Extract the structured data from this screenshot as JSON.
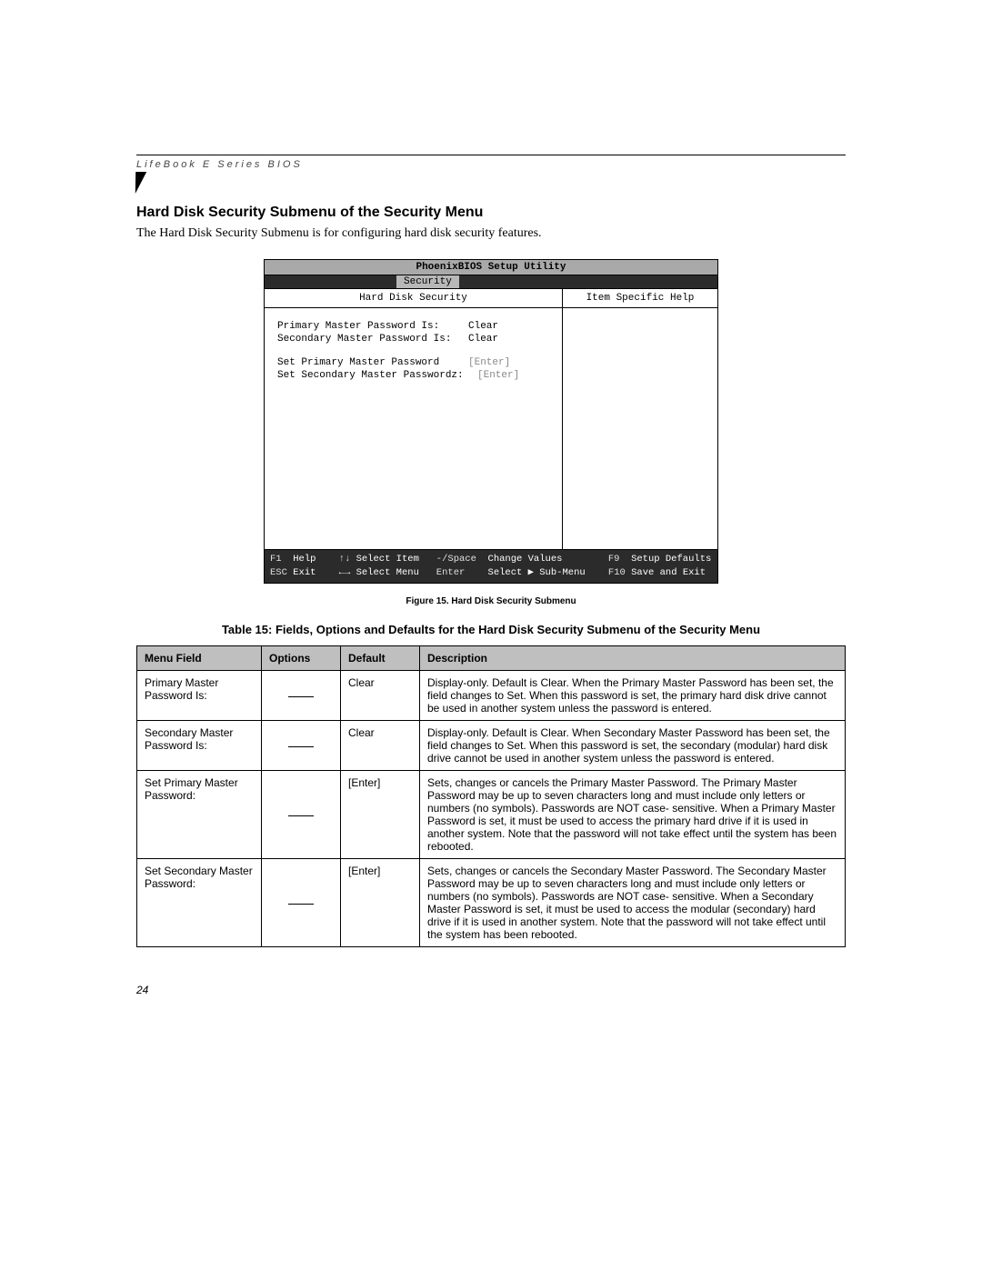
{
  "header": {
    "running": "LifeBook E Series BIOS"
  },
  "section": {
    "title": "Hard Disk Security Submenu of the Security Menu",
    "intro": "The Hard Disk Security Submenu is for configuring hard disk security features."
  },
  "bios": {
    "title": "PhoenixBIOS Setup Utility",
    "tab": "Security",
    "left_head": "Hard Disk Security",
    "right_head": "Item Specific Help",
    "rows": {
      "r1_label": "Primary Master Password Is:",
      "r1_val": "Clear",
      "r2_label": "Secondary Master Password Is:",
      "r2_val": "Clear",
      "r3_label": "Set Primary Master Password",
      "r3_val": "[Enter]",
      "r4_label": "Set Secondary Master Passwordz:",
      "r4_val": "[Enter]"
    },
    "footer": {
      "f1": "F1",
      "help": "Help",
      "arrows_ud": "↑↓",
      "select_item": "Select Item",
      "minus_space": "-/Space",
      "change_values": "Change Values",
      "f9": "F9",
      "setup_defaults": "Setup Defaults",
      "esc": "ESC",
      "exit": "Exit",
      "arrows_lr": "←→",
      "select_menu": "Select Menu",
      "enter": "Enter",
      "select_sub": "Select ▶ Sub-Menu",
      "f10": "F10",
      "save_exit": "Save and Exit"
    }
  },
  "figure_caption": "Figure 15.   Hard Disk Security Submenu",
  "table_caption": "Table 15: Fields, Options and Defaults for the Hard Disk Security Submenu of the Security Menu",
  "table": {
    "headers": {
      "c1": "Menu Field",
      "c2": "Options",
      "c3": "Default",
      "c4": "Description"
    },
    "rows": [
      {
        "field": "Primary Master Password Is:",
        "options": "—",
        "default": "Clear",
        "desc": "Display-only. Default is Clear. When the Primary Master Password has been set, the field changes to Set. When this password is set, the primary hard disk drive cannot be used in another system unless the password is entered."
      },
      {
        "field": "Secondary Master Password Is:",
        "options": "—",
        "default": "Clear",
        "desc": "Display-only. Default is Clear. When Secondary Master Password has been set, the field changes to Set. When this password is set, the secondary (modular) hard disk drive cannot be used in another system unless the password is entered."
      },
      {
        "field": "Set Primary Master Password:",
        "options": "—",
        "default": "[Enter]",
        "desc": "Sets, changes or cancels the Primary Master Password. The Primary Master Password may be up to seven characters long and must include only letters or numbers (no symbols). Passwords are NOT case- sensitive. When a Primary Master Password is set, it must be used to access the primary hard drive if it is used in another system. Note that the password will not take effect until the system has been rebooted."
      },
      {
        "field": "Set Secondary Master Password:",
        "options": "—",
        "default": "[Enter]",
        "desc": "Sets, changes or cancels the Secondary Master Password. The Secondary Master Password may be up to seven characters long and must include only letters or numbers (no symbols). Passwords are NOT case- sensitive. When a Secondary Master Password is set, it must be used to access the modular (secondary) hard drive if it is used in another system. Note that the password will not take effect until the system has been rebooted."
      }
    ]
  },
  "page_number": "24"
}
